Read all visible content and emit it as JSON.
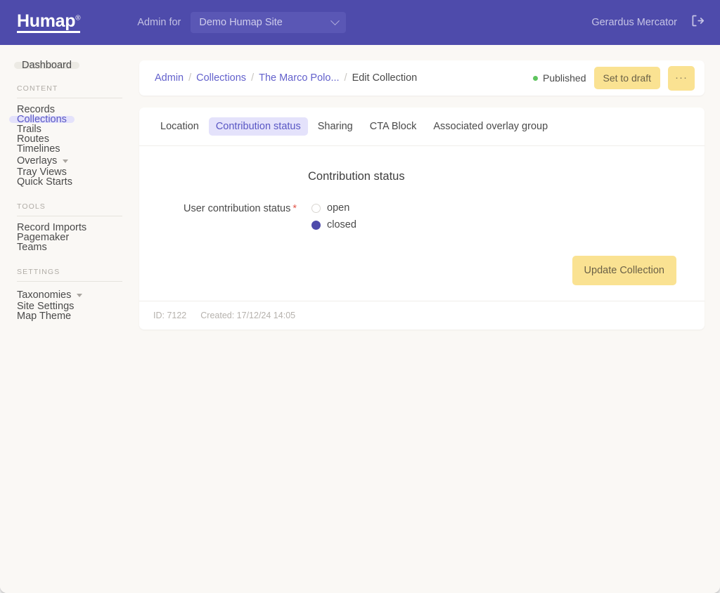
{
  "topbar": {
    "brand": "Humap",
    "brand_mark": "®",
    "admin_for_label": "Admin for",
    "site_select_value": "Demo Humap Site",
    "user_name": "Gerardus Mercator",
    "logout_icon": "logout-icon",
    "background_color": "#4e4bab"
  },
  "sidebar": {
    "dashboard_label": "Dashboard",
    "sections": [
      {
        "label": "CONTENT",
        "items": [
          {
            "label": "Records",
            "active": false,
            "caret": false
          },
          {
            "label": "Collections",
            "active": true,
            "caret": false
          },
          {
            "label": "Trails",
            "active": false,
            "caret": false
          },
          {
            "label": "Routes",
            "active": false,
            "caret": false
          },
          {
            "label": "Timelines",
            "active": false,
            "caret": false
          },
          {
            "label": "Overlays",
            "active": false,
            "caret": true
          },
          {
            "label": "Tray Views",
            "active": false,
            "caret": false
          },
          {
            "label": "Quick Starts",
            "active": false,
            "caret": false
          }
        ]
      },
      {
        "label": "TOOLS",
        "items": [
          {
            "label": "Record Imports",
            "active": false,
            "caret": false
          },
          {
            "label": "Pagemaker",
            "active": false,
            "caret": false
          },
          {
            "label": "Teams",
            "active": false,
            "caret": false
          }
        ]
      },
      {
        "label": "SETTINGS",
        "items": [
          {
            "label": "Taxonomies",
            "active": false,
            "caret": true
          },
          {
            "label": "Site Settings",
            "active": false,
            "caret": false
          },
          {
            "label": "Map Theme",
            "active": false,
            "caret": false
          }
        ]
      }
    ]
  },
  "breadcrumb": {
    "items": [
      {
        "label": "Admin",
        "link": true
      },
      {
        "label": "Collections",
        "link": true
      },
      {
        "label": "The Marco Polo...",
        "link": true
      },
      {
        "label": "Edit Collection",
        "link": false
      }
    ],
    "separator": "/",
    "status_label": "Published",
    "status_color": "#5ec45e",
    "set_to_draft_label": "Set to draft",
    "overflow_label": "···"
  },
  "tabs": [
    {
      "label": "Location",
      "active": false
    },
    {
      "label": "Contribution status",
      "active": true
    },
    {
      "label": "Sharing",
      "active": false
    },
    {
      "label": "CTA Block",
      "active": false
    },
    {
      "label": "Associated overlay group",
      "active": false
    }
  ],
  "panel": {
    "title": "Contribution status",
    "field_label": "User contribution status",
    "required_mark": "*",
    "options": [
      {
        "label": "open",
        "selected": false
      },
      {
        "label": "closed",
        "selected": true
      }
    ],
    "submit_label": "Update Collection"
  },
  "footer": {
    "id_text": "ID: 7122",
    "created_text": "Created: 17/12/24 14:05"
  }
}
